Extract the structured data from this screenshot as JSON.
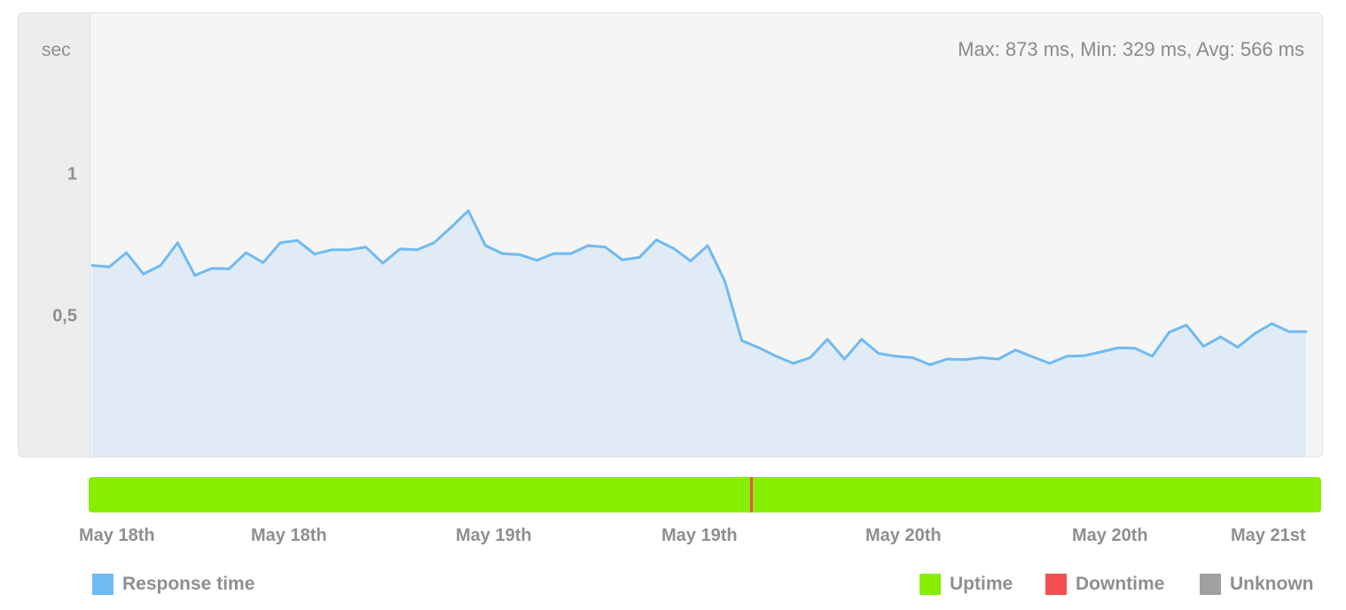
{
  "chart_data": {
    "type": "area",
    "unit_label": "sec",
    "stats_text": "Max: 873 ms, Min: 329 ms, Avg: 566 ms",
    "yticks": [
      {
        "label": "1",
        "value": 1.0
      },
      {
        "label": "0,5",
        "value": 0.5
      }
    ],
    "ylim": [
      0,
      1.5
    ],
    "series": [
      {
        "name": "Response time",
        "color": "#6fbaf2",
        "fill": "#e0ebf5",
        "values": [
          0.68,
          0.675,
          0.725,
          0.65,
          0.68,
          0.76,
          0.645,
          0.67,
          0.668,
          0.725,
          0.69,
          0.76,
          0.768,
          0.72,
          0.735,
          0.735,
          0.745,
          0.688,
          0.738,
          0.735,
          0.76,
          0.815,
          0.873,
          0.75,
          0.722,
          0.718,
          0.698,
          0.722,
          0.722,
          0.75,
          0.745,
          0.7,
          0.708,
          0.77,
          0.74,
          0.696,
          0.75,
          0.625,
          0.415,
          0.39,
          0.36,
          0.335,
          0.355,
          0.42,
          0.35,
          0.42,
          0.37,
          0.36,
          0.355,
          0.33,
          0.35,
          0.348,
          0.355,
          0.35,
          0.382,
          0.358,
          0.335,
          0.36,
          0.362,
          0.375,
          0.39,
          0.388,
          0.36,
          0.445,
          0.47,
          0.395,
          0.428,
          0.392,
          0.44,
          0.475,
          0.447,
          0.447
        ]
      }
    ],
    "x_labels": [
      "May 18th",
      "May 18th",
      "May 19th",
      "May 19th",
      "May 20th",
      "May 20th",
      "May 21st"
    ],
    "status_bar": {
      "uptime_color": "#88ee00",
      "downtime_color": "#f0504f",
      "unknown_color": "#a0a0a0",
      "downtime_at": 0.537,
      "downtime_width": 0.0015
    },
    "legend": {
      "response_time": {
        "label": "Response time",
        "color": "#6fbaf2"
      },
      "uptime": {
        "label": "Uptime",
        "color": "#88ee00"
      },
      "downtime": {
        "label": "Downtime",
        "color": "#f25050"
      },
      "unknown": {
        "label": "Unknown",
        "color": "#a0a0a0"
      }
    }
  }
}
